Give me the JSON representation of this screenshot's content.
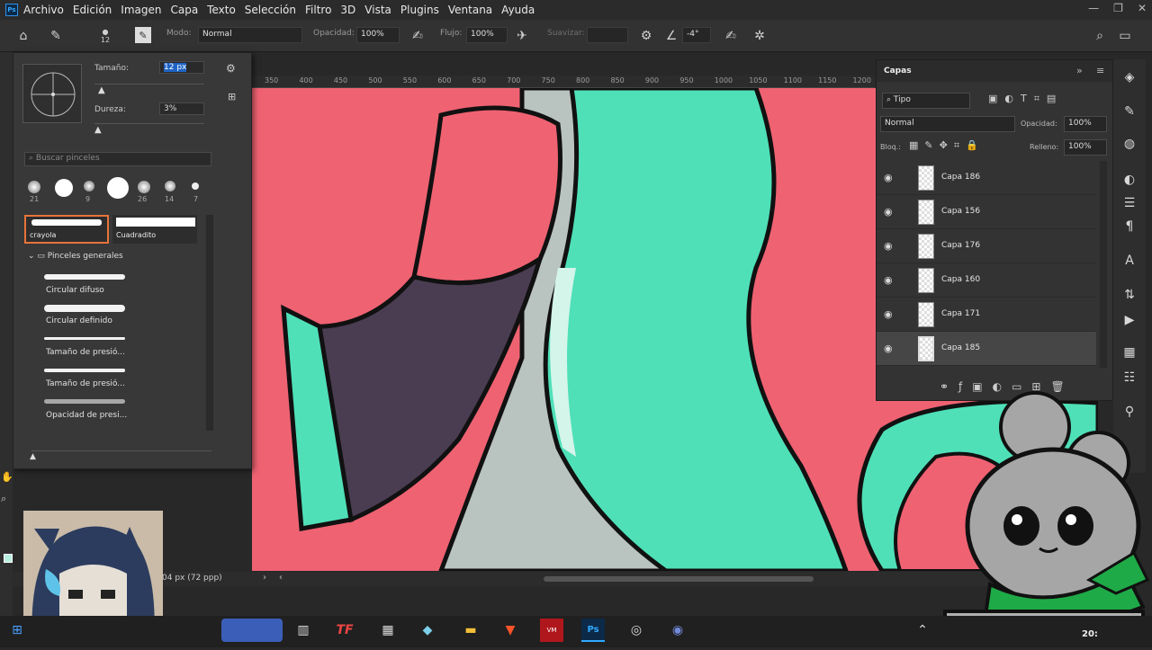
{
  "app": {
    "logo": "Ps"
  },
  "menubar": {
    "items": [
      "Archivo",
      "Edición",
      "Imagen",
      "Capa",
      "Texto",
      "Selección",
      "Filtro",
      "3D",
      "Vista",
      "Plugins",
      "Ventana",
      "Ayuda"
    ]
  },
  "window_controls": {
    "minimize": "—",
    "restore": "❐",
    "close": "✕"
  },
  "options": {
    "brush_size": "12",
    "mode_label": "Modo:",
    "mode_value": "Normal",
    "opacity_label": "Opacidad:",
    "opacity_value": "100%",
    "flow_label": "Flujo:",
    "flow_value": "100%",
    "smoothing_label": "Suavizar:",
    "angle_value": "-4°"
  },
  "ruler": {
    "ticks": [
      "350",
      "400",
      "450",
      "500",
      "550",
      "600",
      "650",
      "700",
      "750",
      "800",
      "850",
      "900",
      "950",
      "1000",
      "1050",
      "1100",
      "1150",
      "1200"
    ]
  },
  "brush_panel": {
    "size_label": "Tamaño:",
    "size_value": "12 px",
    "hardness_label": "Dureza:",
    "hardness_value": "3%",
    "search_placeholder": "Buscar pinceles",
    "recent_sizes": [
      "21",
      "",
      "9",
      "",
      "26",
      "14",
      "7"
    ],
    "presets": [
      "crayola",
      "Cuadradito"
    ],
    "group_name": "Pinceles generales",
    "brushes": [
      "Circular difuso",
      "Circular definido",
      "Tamaño de presió...",
      "Tamaño de presió...",
      "Opacidad de presi..."
    ]
  },
  "layers_panel": {
    "title": "Capas",
    "filter_value": "Tipo",
    "blend_mode": "Normal",
    "opacity_label": "Opacidad:",
    "opacity_value": "100%",
    "lock_label": "Bloq.:",
    "fill_label": "Relleno:",
    "fill_value": "100%",
    "layers": [
      "Capa 186",
      "Capa 156",
      "Capa 176",
      "Capa 160",
      "Capa 171",
      "Capa 185"
    ],
    "active_layer": "Capa 185"
  },
  "statusbar": {
    "doc_info": "04 px (72 ppp)"
  },
  "taskbar": {
    "clock": "20:"
  },
  "colors": {
    "canvas_bg": "#ef6272",
    "teal": "#4fe0b8",
    "purple": "#4a3d52",
    "gray": "#b8c2bf",
    "dark_ui": "#323232"
  }
}
